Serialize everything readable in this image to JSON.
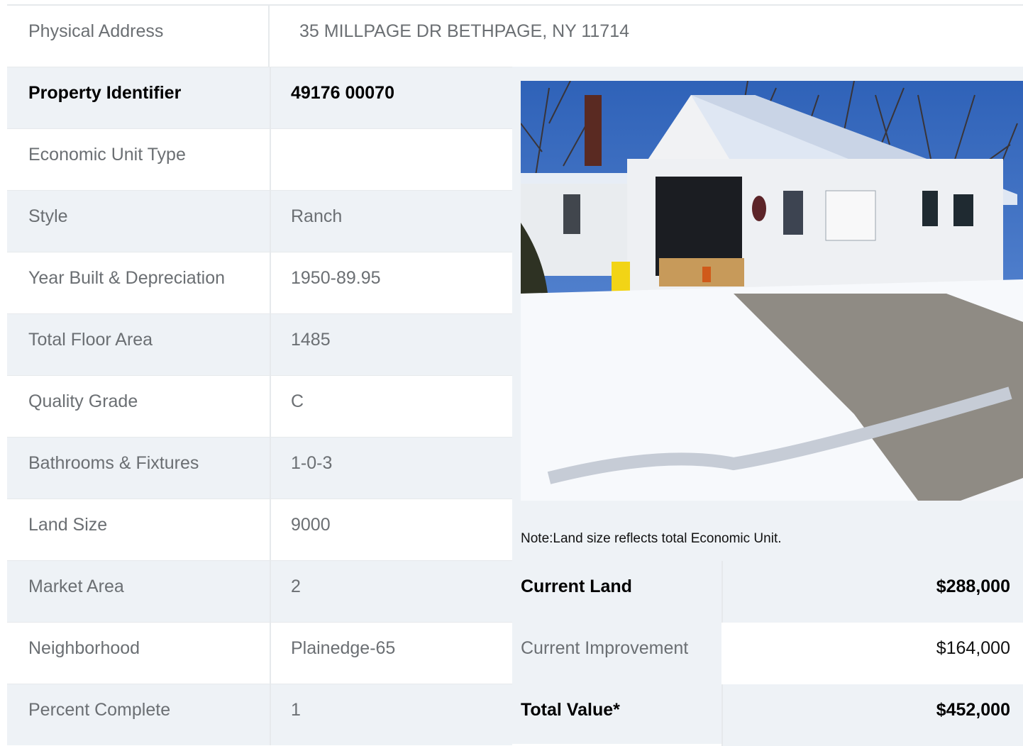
{
  "address": {
    "label": "Physical Address",
    "value": "35  MILLPAGE DR  BETHPAGE, NY  11714"
  },
  "rows": [
    {
      "label": "Property Identifier",
      "value": "49176  00070"
    },
    {
      "label": "Economic Unit Type",
      "value": ""
    },
    {
      "label": "Style",
      "value": "Ranch"
    },
    {
      "label": "Year Built & Depreciation",
      "value": "1950-89.95"
    },
    {
      "label": "Total Floor Area",
      "value": "1485"
    },
    {
      "label": "Quality Grade",
      "value": "C"
    },
    {
      "label": "Bathrooms & Fixtures",
      "value": "1-0-3"
    },
    {
      "label": "Land Size",
      "value": "9000"
    },
    {
      "label": "Market Area",
      "value": "2"
    },
    {
      "label": "Neighborhood",
      "value": "Plainedge-65"
    },
    {
      "label": "Percent Complete",
      "value": "1"
    }
  ],
  "note": "Note:Land size reflects total Economic Unit.",
  "valuation": [
    {
      "label": "Current Land",
      "value": "$288,000"
    },
    {
      "label": "Current Improvement",
      "value": "$164,000"
    },
    {
      "label": "Total Value*",
      "value": "$452,000"
    }
  ]
}
